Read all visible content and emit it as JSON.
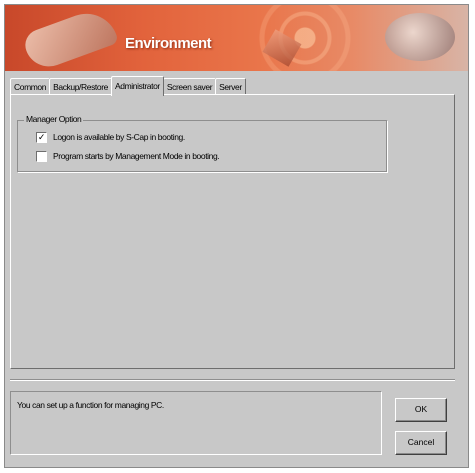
{
  "window": {
    "title": "Environment"
  },
  "tabs": [
    {
      "label": "Common",
      "active": false
    },
    {
      "label": "Backup/Restore",
      "active": false
    },
    {
      "label": "Administrator",
      "active": true
    },
    {
      "label": "Screen saver",
      "active": false
    },
    {
      "label": "Server",
      "active": false
    }
  ],
  "manager_option": {
    "legend": "Manager Option",
    "options": [
      {
        "label": "Logon is available by S-Cap in booting.",
        "checked": true
      },
      {
        "label": "Program starts by Management Mode in booting.",
        "checked": false
      }
    ]
  },
  "message": "You can set up a function for managing PC.",
  "buttons": {
    "ok": "OK",
    "cancel": "Cancel"
  },
  "checkmark_glyph": "✓"
}
